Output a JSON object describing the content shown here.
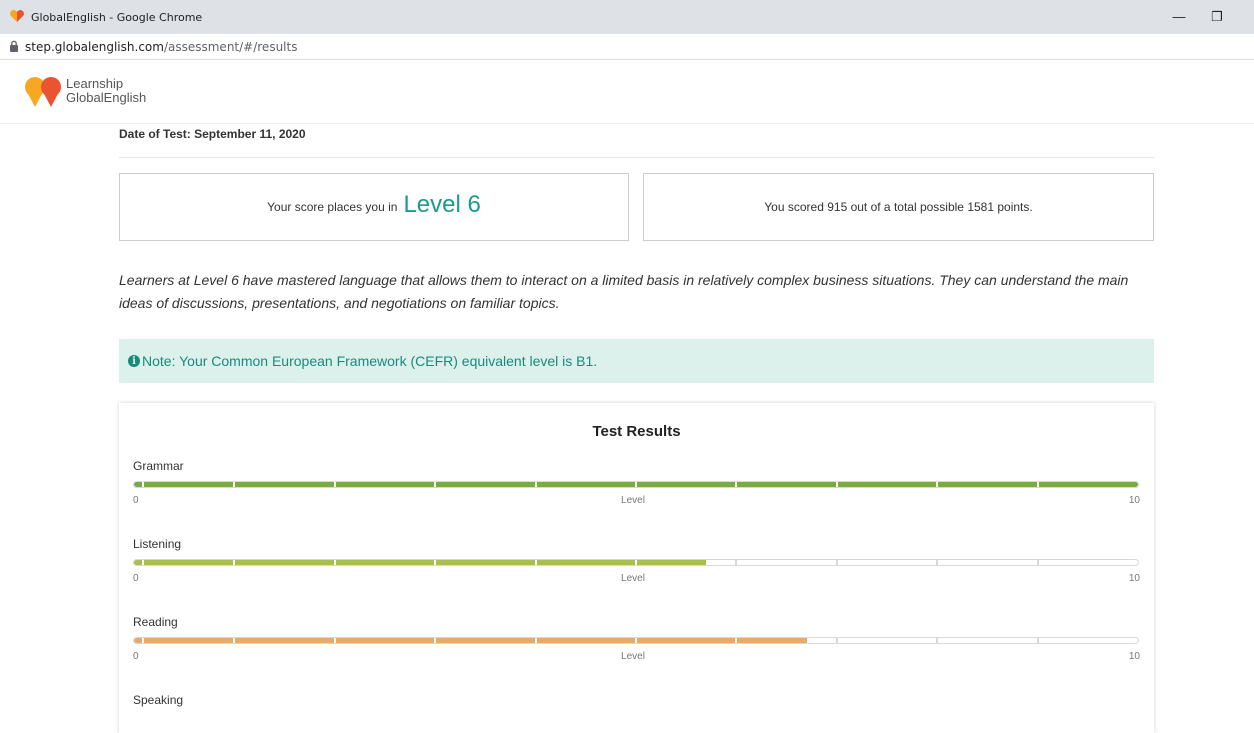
{
  "browser": {
    "window_title": "GlobalEnglish - Google Chrome",
    "url_host": "step.globalenglish.com",
    "url_path": "/assessment/#/results"
  },
  "site": {
    "logo_line1": "Learnship",
    "logo_line2": "GlobalEnglish"
  },
  "results": {
    "date_label": "Date of Test: September 11, 2020",
    "score_prefix": "Your score places you in",
    "level_text": "Level 6",
    "points_text": "You scored 915 out of a total possible 1581 points.",
    "description": "Learners at Level 6 have mastered language that allows them to interact on a limited basis in relatively complex business situations. They can understand the main ideas of discussions, presentations, and negotiations on familiar topics.",
    "note_text": "Note: Your Common European Framework (CEFR) equivalent level is B1.",
    "card_title": "Test Results",
    "scale_min": "0",
    "scale_mid": "Level",
    "scale_max": "10",
    "skills": [
      {
        "name": "Grammar",
        "level": 10,
        "color": "#7aa84c"
      },
      {
        "name": "Listening",
        "level": 5.7,
        "color": "#a8bf4e"
      },
      {
        "name": "Reading",
        "level": 6.7,
        "color": "#e9a96a"
      },
      {
        "name": "Speaking",
        "level": null,
        "color": "#7aa84c"
      }
    ]
  },
  "colors": {
    "accent_teal": "#1a9c8c",
    "note_bg": "#dcf0ec"
  },
  "icons": {
    "favicon": "heart-logo-icon",
    "lock": "lock-icon",
    "info": "info-circle-icon"
  }
}
